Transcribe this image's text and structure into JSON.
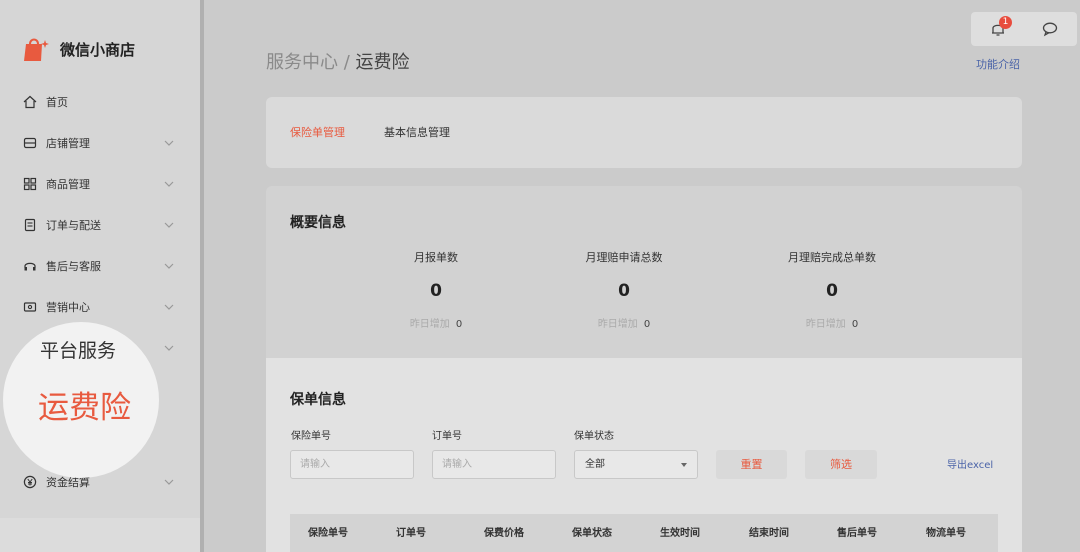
{
  "brand": {
    "name": "微信小商店"
  },
  "nav": [
    {
      "label": "首页",
      "icon": "home-icon"
    },
    {
      "label": "店铺管理",
      "icon": "store-icon"
    },
    {
      "label": "商品管理",
      "icon": "grid-icon"
    },
    {
      "label": "订单与配送",
      "icon": "order-icon"
    },
    {
      "label": "售后与客服",
      "icon": "headset-icon"
    },
    {
      "label": "营销中心",
      "icon": "ticket-icon"
    },
    {
      "label": "资金结算",
      "icon": "yen-icon"
    }
  ],
  "highlight": {
    "group": "平台服务",
    "item": "运费险"
  },
  "topbar": {
    "badge_count": "1"
  },
  "breadcrumb": {
    "parent": "服务中心",
    "separator": " / ",
    "current": "运费险"
  },
  "func_link": "功能介绍",
  "tabs": [
    {
      "label": "保险单管理",
      "active": true
    },
    {
      "label": "基本信息管理",
      "active": false
    }
  ],
  "summary": {
    "title": "概要信息",
    "stats": [
      {
        "label": "月报单数",
        "value": "0",
        "sub_label": "昨日增加",
        "sub_value": "0"
      },
      {
        "label": "月理赔申请总数",
        "value": "0",
        "sub_label": "昨日增加",
        "sub_value": "0"
      },
      {
        "label": "月理赔完成总单数",
        "value": "0",
        "sub_label": "昨日增加",
        "sub_value": "0"
      }
    ]
  },
  "policy": {
    "title": "保单信息",
    "fields": {
      "policy_no_label": "保险单号",
      "policy_no_placeholder": "请输入",
      "order_no_label": "订单号",
      "order_no_placeholder": "请输入",
      "status_label": "保单状态",
      "status_value": "全部"
    },
    "reset_label": "重置",
    "filter_label": "筛选",
    "export_label": "导出excel",
    "columns": [
      "保险单号",
      "订单号",
      "保费价格",
      "保单状态",
      "生效时间",
      "结束时间",
      "售后单号",
      "物流单号"
    ]
  },
  "colors": {
    "accent": "#e85a3f",
    "link": "#4a63a8"
  }
}
